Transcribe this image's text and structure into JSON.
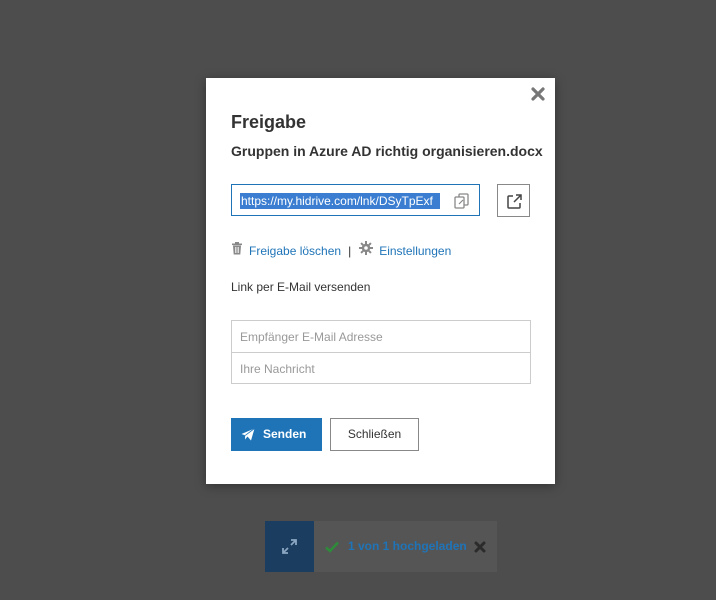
{
  "dialog": {
    "title": "Freigabe",
    "filename": "Gruppen in Azure AD richtig organisieren.docx",
    "share_link": "https://my.hidrive.com/lnk/DSyTpExf",
    "delete_share_label": "Freigabe löschen",
    "separator": "|",
    "settings_label": "Einstellungen",
    "mail_section_label": "Link per E-Mail versenden",
    "recipient_placeholder": "Empfänger E-Mail Adresse",
    "recipient_value": "",
    "message_placeholder": "Ihre Nachricht",
    "message_value": "",
    "send_label": "Senden",
    "close_label": "Schließen"
  },
  "upload_status": {
    "text": "1 von 1 hochgeladen"
  },
  "icons": {
    "close": "close-x-icon",
    "copy": "copy-icon",
    "open_external": "external-link-icon",
    "trash": "trash-icon",
    "settings": "gear-icon",
    "send": "paper-plane-icon",
    "expand": "expand-icon",
    "check": "check-icon",
    "dismiss": "dismiss-x-icon"
  },
  "colors": {
    "accent": "#1f74b8",
    "backdrop": "#4d4d4d",
    "success": "#2e8b3a",
    "upload_panel": "#555555",
    "upload_expand": "#1a3d60"
  }
}
